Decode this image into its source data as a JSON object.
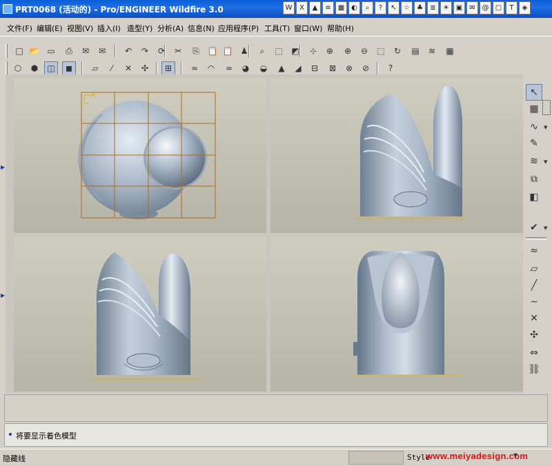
{
  "window": {
    "title": "PRT0068 (活动的) - Pro/ENGINEER Wildfire 3.0"
  },
  "menu": [
    "文件(F)",
    "编辑(E)",
    "视图(V)",
    "插入(I)",
    "造型(Y)",
    "分析(A)",
    "信息(N)",
    "应用程序(P)",
    "工具(T)",
    "窗口(W)",
    "帮助(H)"
  ],
  "taskbar_icons": [
    "word-icon",
    "excel-icon",
    "ppt-icon",
    "book-icon",
    "image-icon",
    "web-icon",
    "find-icon",
    "help-icon",
    "cursor-icon",
    "fav-icon",
    "qq-icon",
    "note-icon",
    "sun-icon",
    "snap-icon",
    "mail-icon",
    "at-icon",
    "window-icon",
    "text-icon",
    "shield-icon"
  ],
  "toolbar1": [
    "new-icon",
    "open-icon",
    "save-icon",
    "print-icon",
    "mail-icon",
    "mail-send-icon",
    "undo-icon",
    "redo-icon",
    "regenerate-icon",
    "cut-icon",
    "copy-icon",
    "paste-icon",
    "paste-special-icon",
    "model-player-icon",
    "find-icon",
    "select-box-icon",
    "analysis-icon",
    "snap-icon",
    "plane-icon",
    "zoom-in-icon",
    "zoom-out-icon",
    "refit-icon",
    "orient-icon",
    "saved-views-icon",
    "layers-icon",
    "view-manager-icon"
  ],
  "toolbar2": [
    "wireframe-icon",
    "hidden-line-icon",
    "no-hidden-icon",
    "shading-icon",
    "datum-plane-icon",
    "datum-axis-icon",
    "datum-point-icon",
    "csys-icon",
    "grid-view-icon",
    "surface-tool-icon",
    "curvature-icon",
    "reflection-icon",
    "shade-analysis-icon",
    "draft-analysis-icon",
    "slope-icon",
    "section-icon",
    "offset-icon",
    "connect-icon",
    "delete-analysis-icon",
    "hide-analysis-icon",
    "whats-this-icon"
  ],
  "right_tools": [
    "select-arrow-icon",
    "style-plane-icon",
    "curve-icon",
    "curve-edit-icon",
    "surface-icon",
    "surface-connect-icon",
    "trim-icon",
    "done-icon",
    "curve-offset-icon",
    "plane-icon",
    "line-icon",
    "spline-icon",
    "point-icon",
    "datum-icon",
    "dim-icon",
    "link-icon"
  ],
  "message": {
    "primary": "将要显示着色模型"
  },
  "status": {
    "left": "隐藏线",
    "style": "Style",
    "watermark": "www.meiyadesign.com"
  },
  "colors": {
    "titlebar": "#0a5fd8",
    "viewport_bg": "#c4c2b4",
    "model": "#9aa8b8",
    "grid": "#b06a1a",
    "watermark": "#e01010"
  }
}
